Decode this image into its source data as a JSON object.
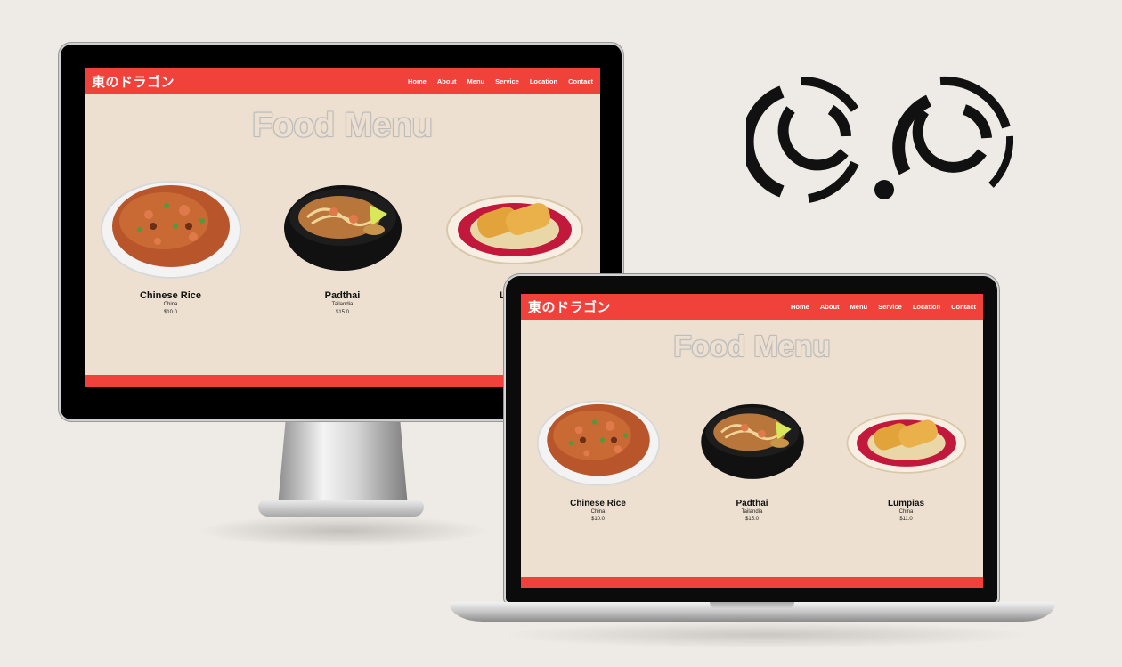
{
  "site": {
    "logo": "東のドラゴン",
    "nav": [
      "Home",
      "About",
      "Menu",
      "Service",
      "Location",
      "Contact"
    ],
    "title": "Food Menu",
    "dishes": [
      {
        "name": "Chinese Rice",
        "origin": "China",
        "price": "$10.0"
      },
      {
        "name": "Padthai",
        "origin": "Tailandia",
        "price": "$15.0"
      },
      {
        "name": "Lumpias",
        "origin": "China",
        "price": "$11.0"
      }
    ],
    "desktop_third_dish_visible_name": "Lumpi",
    "desktop_third_dish_visible_origin": "China"
  },
  "colors": {
    "accent": "#f0413b",
    "page_background": "#ede0d0",
    "backdrop": "#eeeae5"
  },
  "icons": [
    "brand-mark-icon",
    "rice-dish-icon",
    "noodle-bowl-icon",
    "spring-roll-plate-icon"
  ]
}
